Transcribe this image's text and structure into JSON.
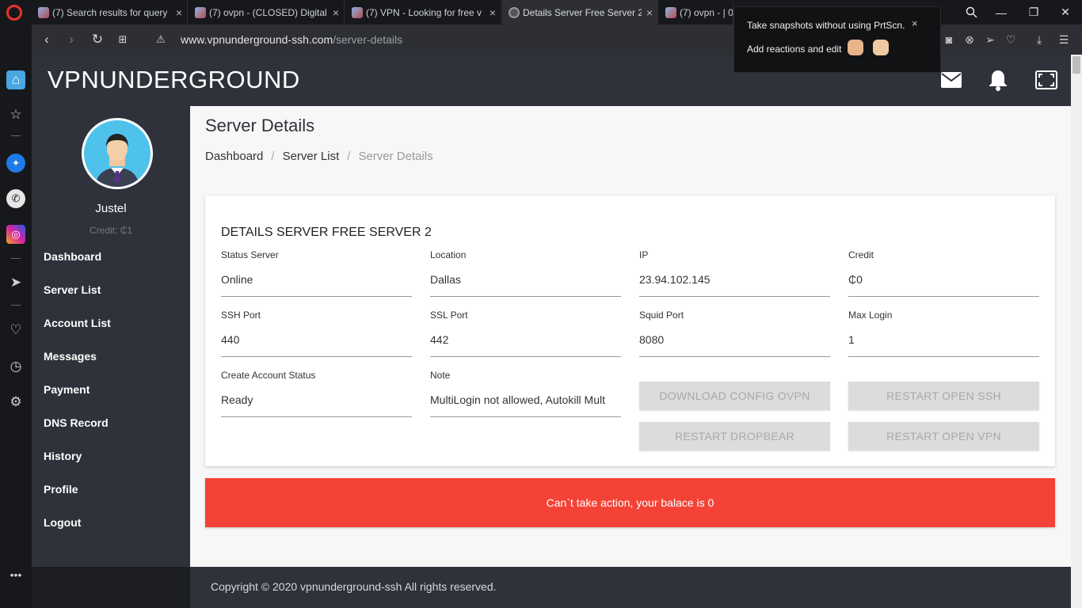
{
  "browser": {
    "tabs": [
      {
        "title": "(7) Search results for query"
      },
      {
        "title": "(7) ovpn - (CLOSED) Digital"
      },
      {
        "title": "(7) VPN - Looking for free v"
      },
      {
        "title": "Details Server Free Server 2"
      },
      {
        "title": "(7) ovpn - | 0"
      }
    ],
    "url_host": "www.vpnunderground-ssh.com",
    "url_path": "/server-details"
  },
  "popup": {
    "line1": "Take snapshots without using PrtScn.",
    "line2": "Add reactions and edit",
    "close": "×"
  },
  "header": {
    "logo": "VPNUNDERGROUND",
    "icons": [
      "mail-icon",
      "bell-icon",
      "fullscreen-icon"
    ]
  },
  "user": {
    "name": "Justel",
    "credit": "Credit: ₵1"
  },
  "menu": [
    {
      "label": "Dashboard"
    },
    {
      "label": "Server List"
    },
    {
      "label": "Account List"
    },
    {
      "label": "Messages"
    },
    {
      "label": "Payment"
    },
    {
      "label": "DNS Record"
    },
    {
      "label": "History"
    },
    {
      "label": "Profile"
    },
    {
      "label": "Logout"
    }
  ],
  "page": {
    "title": "Server Details",
    "breadcrumb": [
      "Dashboard",
      "Server List",
      "Server Details"
    ],
    "card_title": "DETAILS SERVER FREE SERVER 2"
  },
  "fields": {
    "status": {
      "label": "Status Server",
      "value": "Online"
    },
    "location": {
      "label": "Location",
      "value": "Dallas"
    },
    "ip": {
      "label": "IP",
      "value": "23.94.102.145"
    },
    "credit": {
      "label": "Credit",
      "value": "₵0"
    },
    "ssh_port": {
      "label": "SSH Port",
      "value": "440"
    },
    "ssl_port": {
      "label": "SSL Port",
      "value": "442"
    },
    "squid_port": {
      "label": "Squid Port",
      "value": "8080"
    },
    "max_login": {
      "label": "Max Login",
      "value": "1"
    },
    "create_status": {
      "label": "Create Account Status",
      "value": "Ready"
    },
    "note": {
      "label": "Note",
      "value": "MultiLogin not allowed, Autokill Mult"
    }
  },
  "buttons": {
    "download_config": "DOWNLOAD CONFIG OVPN",
    "restart_ssh": "RESTART OPEN SSH",
    "restart_dropbear": "RESTART DROPBEAR",
    "restart_vpn": "RESTART OPEN VPN"
  },
  "alert": "Can`t take action, your balace is 0",
  "footer": "Copyright © 2020 vpnunderground-ssh All rights reserved.",
  "colors": {
    "header_bg": "#2f323b",
    "alert_bg": "#f44336",
    "disabled_button_bg": "#dcdcdc"
  }
}
